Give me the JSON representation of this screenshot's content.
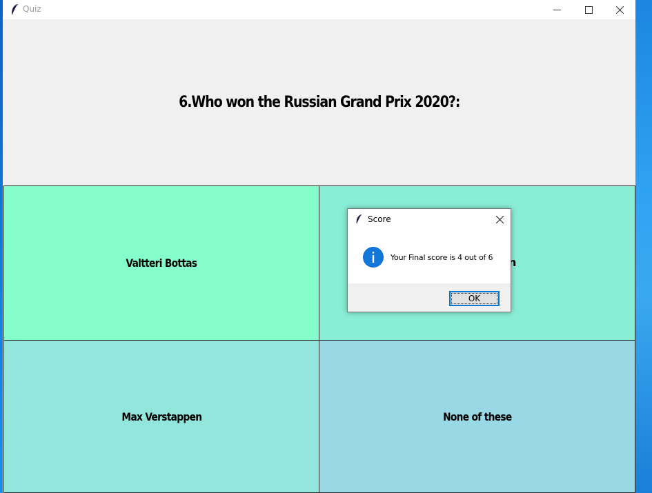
{
  "window": {
    "title": "Quiz",
    "icon": "feather-icon"
  },
  "quiz": {
    "question": "6.Who won the Russian Grand Prix 2020?:",
    "options": [
      {
        "label": "Valtteri Bottas",
        "color": "#86fecb"
      },
      {
        "label": "n",
        "color": "#8aeed6"
      },
      {
        "label": "Max Verstappen",
        "color": "#92e6db"
      },
      {
        "label": "None of these",
        "color": "#98d9e5"
      }
    ]
  },
  "dialog": {
    "title": "Score",
    "icon": "info-icon",
    "message": "Your Final score is 4 out of 6",
    "ok_label": "OK"
  },
  "colors": {
    "question_bg": "#f0f0f0",
    "accent": "#0078d7"
  }
}
